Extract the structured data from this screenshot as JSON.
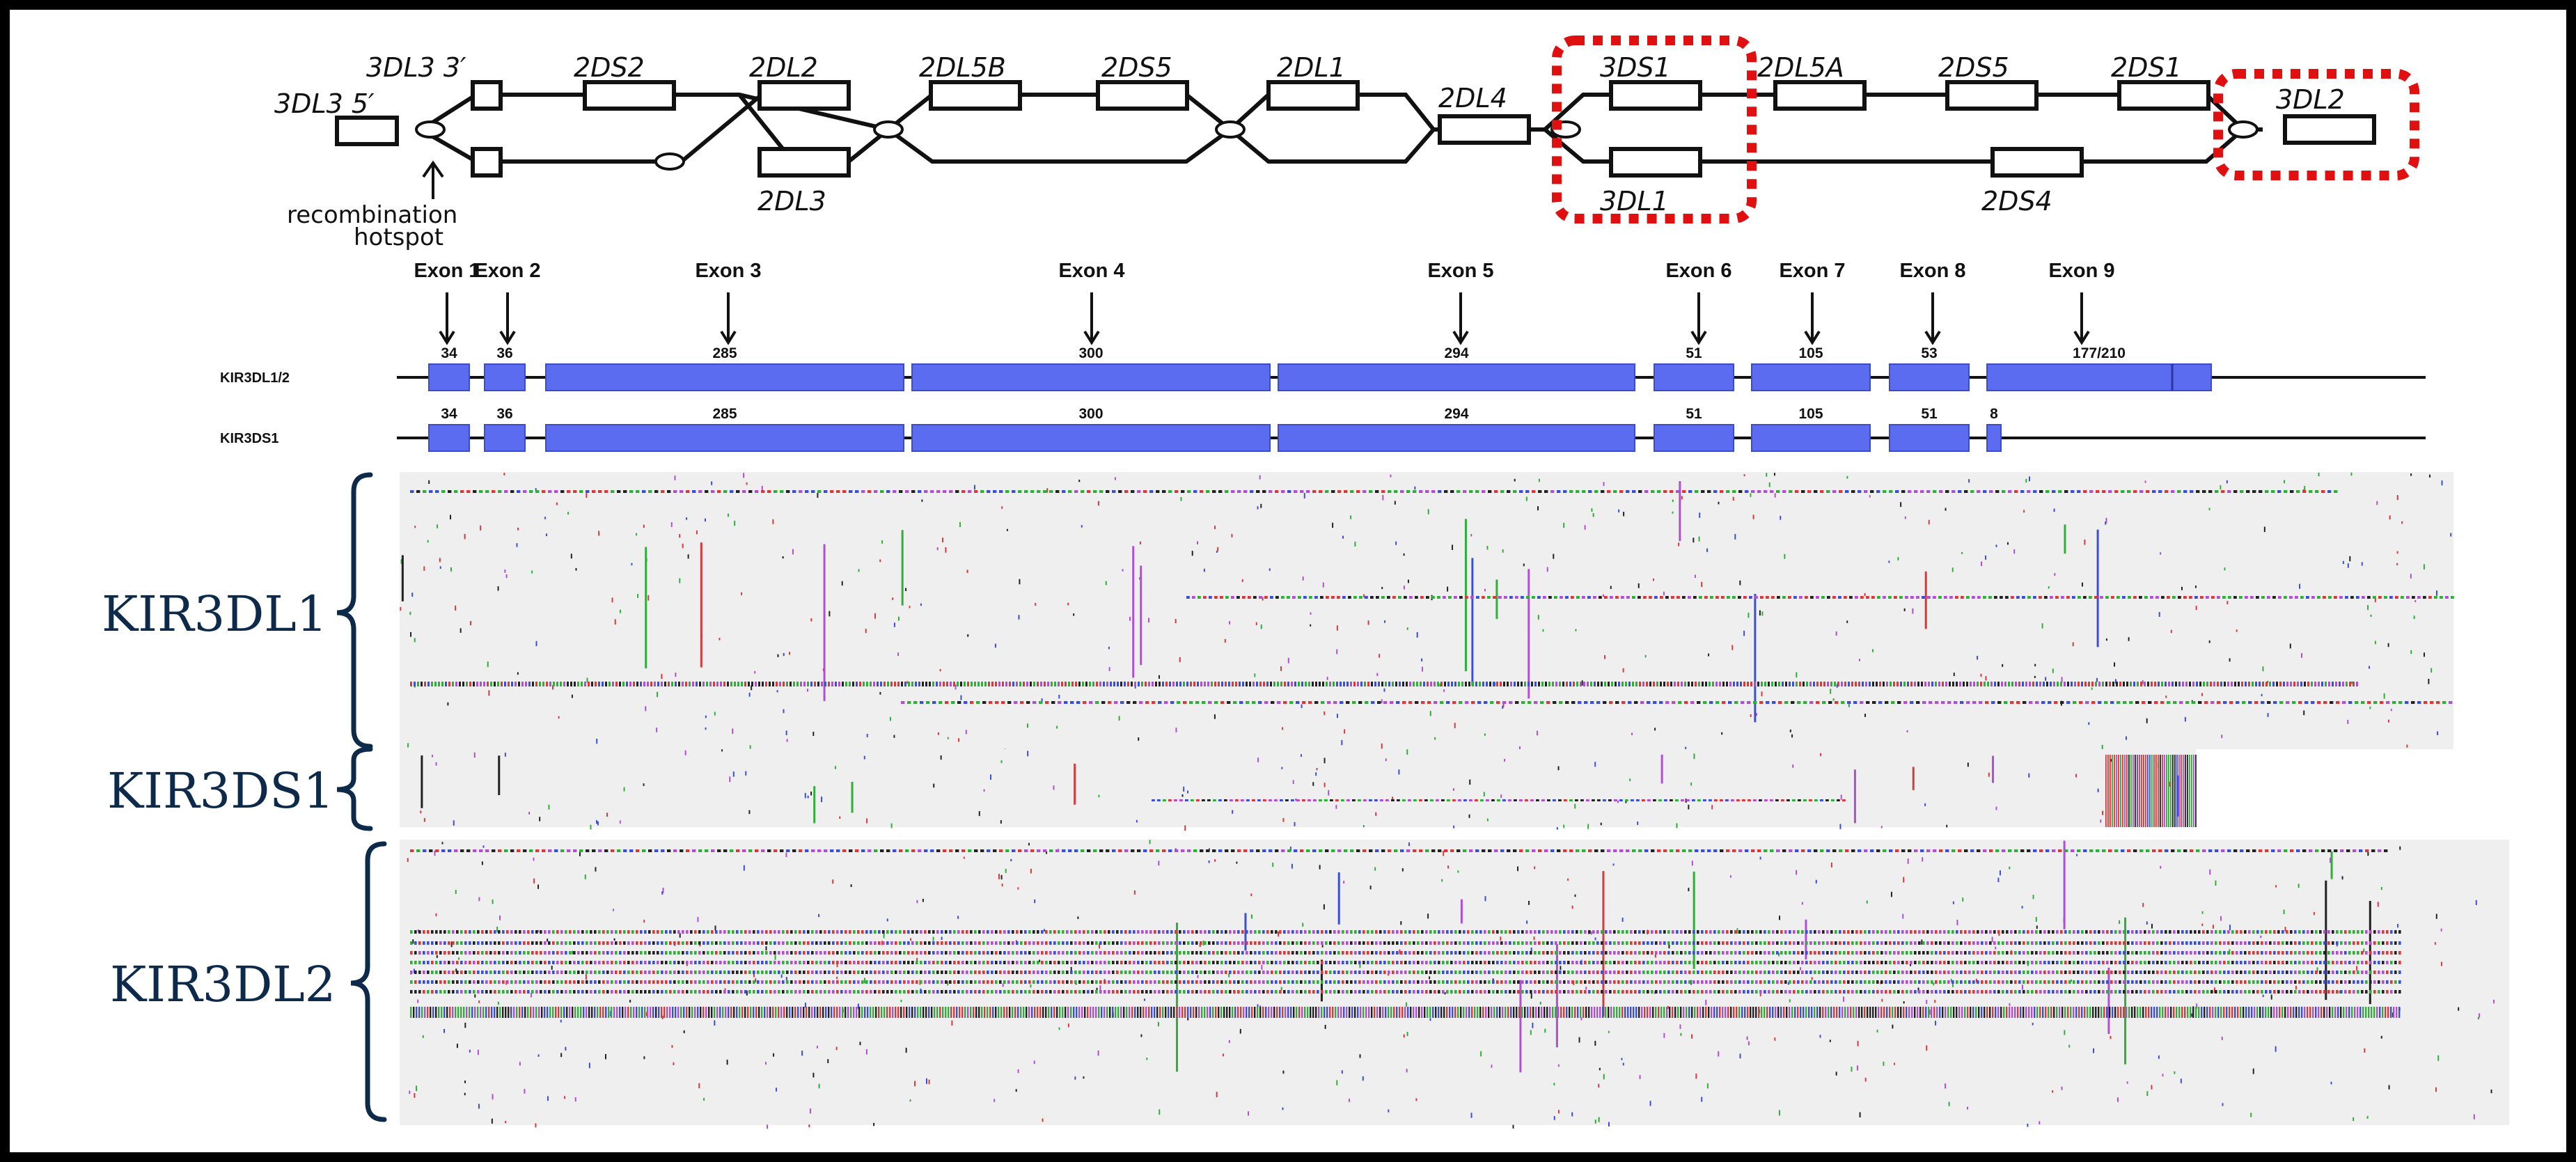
{
  "locus": {
    "genes": {
      "g3DL3_5": "3DL3 5′",
      "g3DL3_3": "3DL3 3′",
      "g2DS2": "2DS2",
      "g2DL2": "2DL2",
      "g2DL3": "2DL3",
      "g2DL5B": "2DL5B",
      "g2DS5a": "2DS5",
      "g2DL1": "2DL1",
      "g2DL4": "2DL4",
      "g3DS1": "3DS1",
      "g3DL1": "3DL1",
      "g2DL5A": "2DL5A",
      "g2DS5b": "2DS5",
      "g2DS1": "2DS1",
      "g2DS4": "2DS4",
      "g3DL2": "3DL2"
    },
    "hotspot_line1": "recombination",
    "hotspot_line2": "hotspot",
    "highlight_color": "#e01010"
  },
  "exons": {
    "labels": [
      "Exon 1",
      "Exon 2",
      "Exon 3",
      "Exon 4",
      "Exon 5",
      "Exon 6",
      "Exon 7",
      "Exon 8",
      "Exon 9"
    ],
    "tracks": [
      {
        "name": "KIR3DL1/2",
        "lengths": [
          "34",
          "36",
          "285",
          "300",
          "294",
          "51",
          "105",
          "53",
          "177/210"
        ]
      },
      {
        "name": "KIR3DS1",
        "lengths": [
          "34",
          "36",
          "285",
          "300",
          "294",
          "51",
          "105",
          "51",
          "8"
        ]
      }
    ],
    "exon_color": "#5b6cf0"
  },
  "alignment": {
    "groups": [
      "KIR3DL1",
      "KIR3DS1",
      "KIR3DL2"
    ],
    "brace_color": "#0e2a4a",
    "base_colors": [
      "#d63a3a",
      "#2fae3a",
      "#3a4ed6",
      "#222222",
      "#b04fd0"
    ]
  }
}
